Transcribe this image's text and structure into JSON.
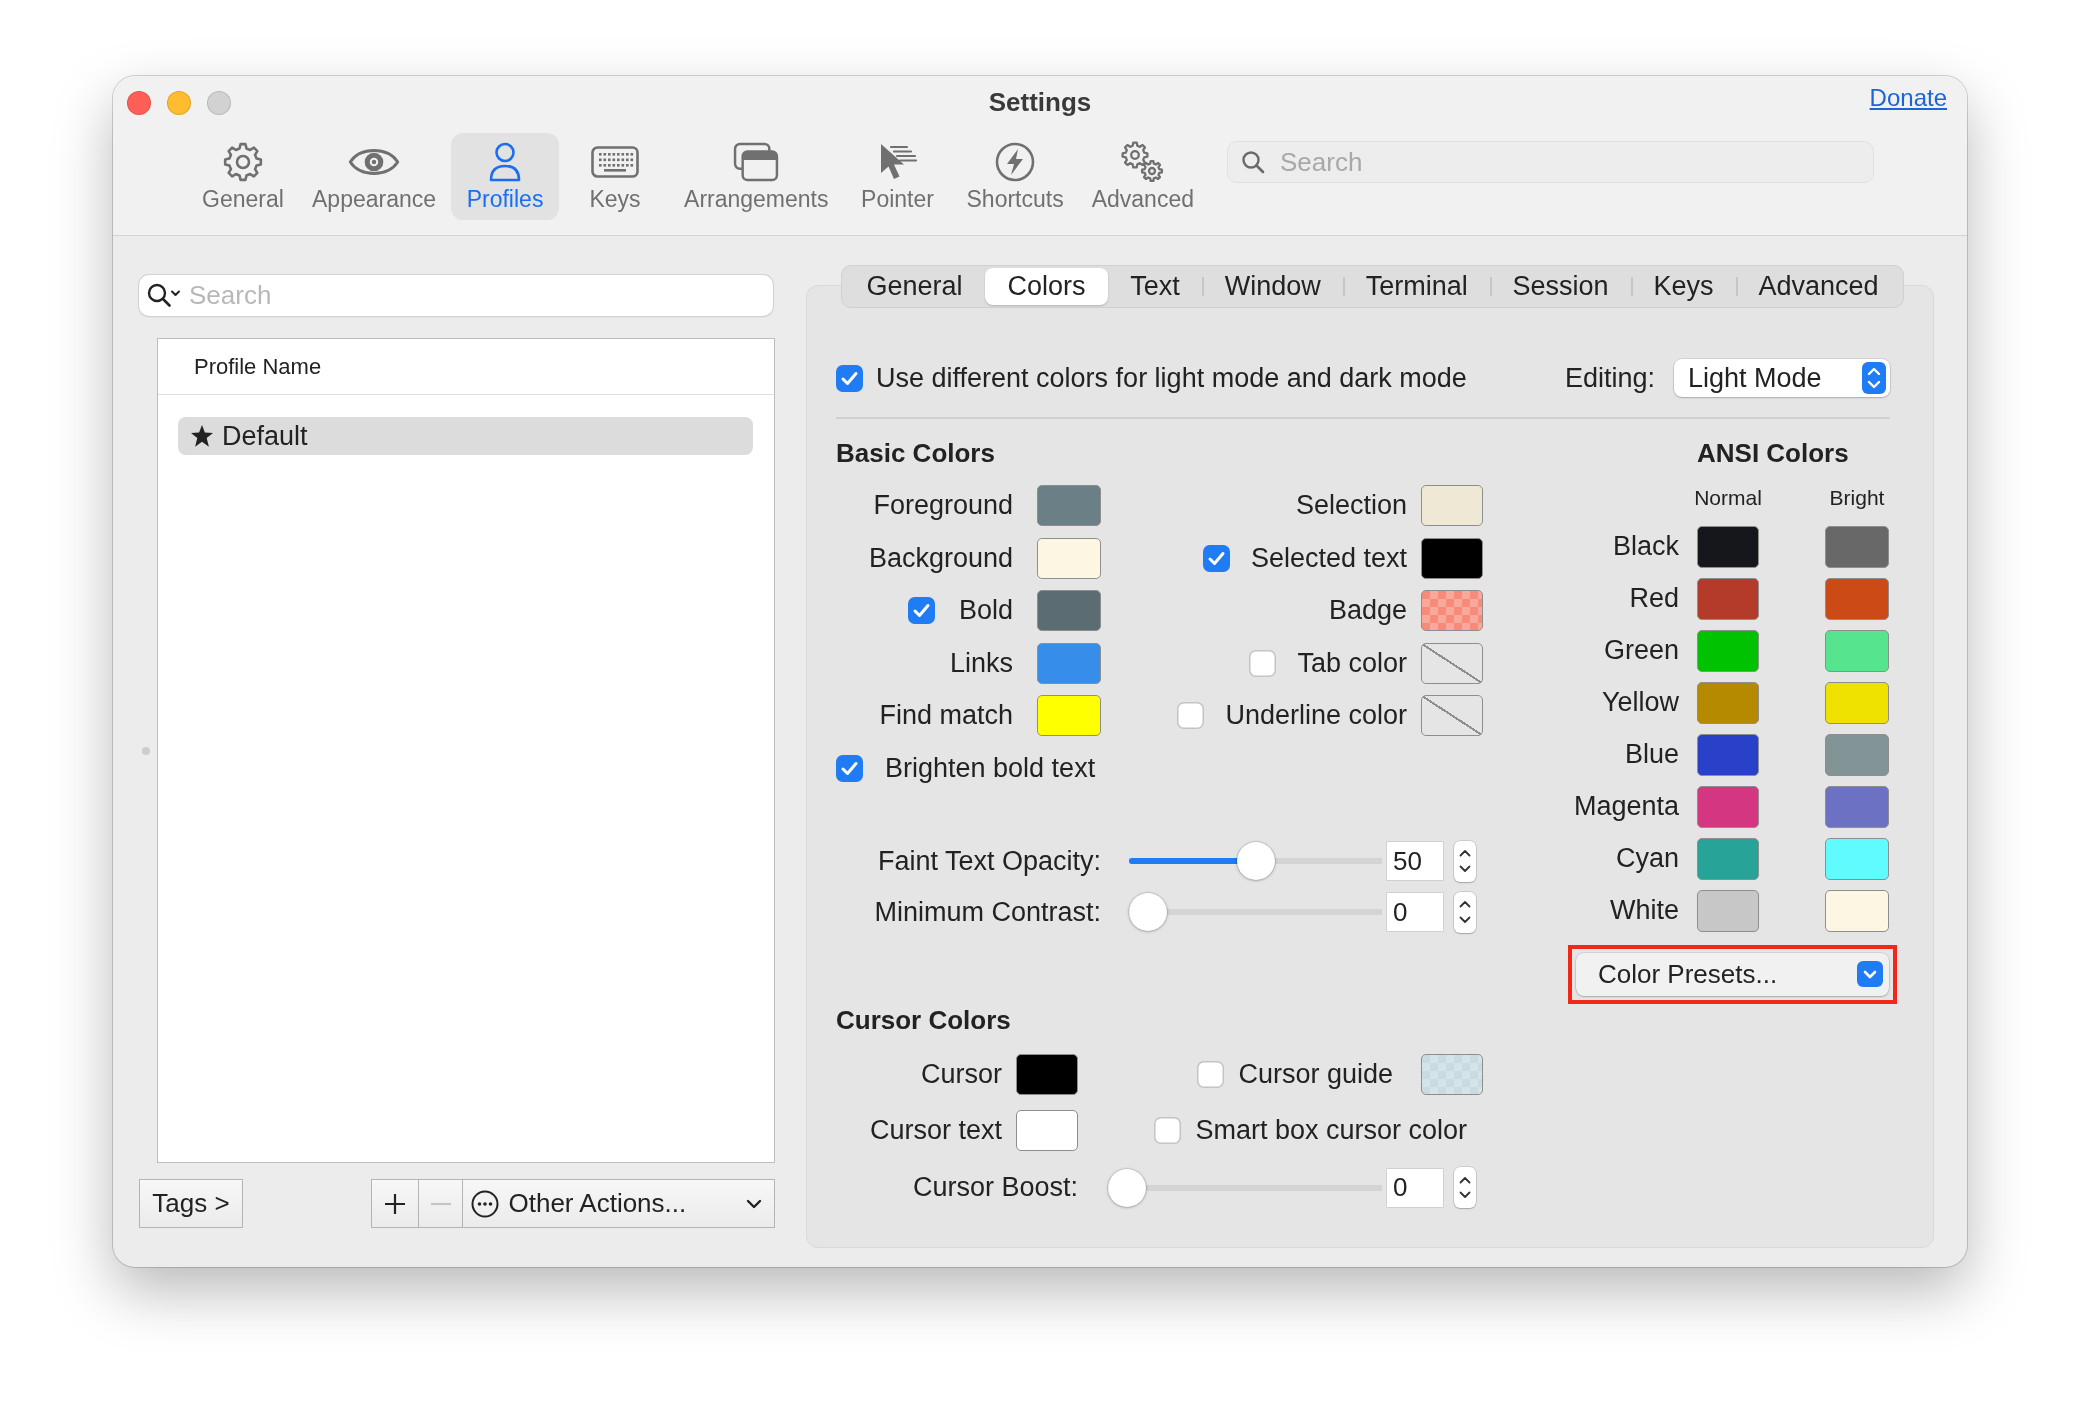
{
  "window": {
    "title": "Settings",
    "controls": [
      {
        "kind": "close",
        "disabled": false
      },
      {
        "kind": "minimize",
        "disabled": false
      },
      {
        "kind": "zoom",
        "disabled": true
      }
    ],
    "link": "Donate"
  },
  "toolbar": {
    "items": [
      {
        "label": "General",
        "selected": false
      },
      {
        "label": "Appearance",
        "selected": false
      },
      {
        "label": "Profiles",
        "selected": true
      },
      {
        "label": "Keys",
        "selected": false
      },
      {
        "label": "Arrangements",
        "selected": false
      },
      {
        "label": "Pointer",
        "selected": false
      },
      {
        "label": "Shortcuts",
        "selected": false
      },
      {
        "label": "Advanced",
        "selected": false
      }
    ],
    "search": {
      "placeholder": "Search"
    }
  },
  "profiles_pane": {
    "search": {
      "placeholder": "Search"
    },
    "table": {
      "columns": [
        "Profile Name"
      ],
      "rows": [
        {
          "name": "Default",
          "default": true,
          "selected": true
        }
      ]
    },
    "tags_button": "Tags >",
    "add_button": {
      "disabled": false
    },
    "remove_button": {
      "disabled": true
    },
    "actions_menu": "Other Actions..."
  },
  "profile_tabs": [
    {
      "label": "General",
      "selected": false
    },
    {
      "label": "Colors",
      "selected": true
    },
    {
      "label": "Text",
      "selected": false
    },
    {
      "label": "Window",
      "selected": false
    },
    {
      "label": "Terminal",
      "selected": false
    },
    {
      "label": "Session",
      "selected": false
    },
    {
      "label": "Keys",
      "selected": false
    },
    {
      "label": "Advanced",
      "selected": false
    }
  ],
  "colors": {
    "mode_toggle": {
      "label": "Use different colors for light mode and dark mode",
      "checked": true
    },
    "editing": {
      "label": "Editing:",
      "value": "Light Mode"
    },
    "basic_colors": {
      "title": "Basic Colors",
      "items": [
        {
          "label": "Foreground",
          "kind": "plain",
          "swatch": {
            "kind": "solid",
            "color": "#6a7f86"
          }
        },
        {
          "label": "Selection",
          "kind": "plain",
          "swatch": {
            "kind": "solid",
            "color": "#eee8d5"
          }
        },
        {
          "label": "Background",
          "kind": "plain",
          "swatch": {
            "kind": "solid",
            "color": "#fdf6e3"
          }
        },
        {
          "label": "Selected text",
          "kind": "checkbox",
          "checked": true,
          "swatch": {
            "kind": "solid",
            "color": "#000000"
          }
        },
        {
          "label": "Bold",
          "kind": "checkbox",
          "checked": true,
          "swatch": {
            "kind": "solid",
            "color": "#5b6d72"
          }
        },
        {
          "label": "Badge",
          "kind": "plain",
          "swatch": {
            "kind": "translucent",
            "color": "#f78b7a"
          }
        },
        {
          "label": "Links",
          "kind": "plain",
          "swatch": {
            "kind": "solid",
            "color": "#368eea"
          }
        },
        {
          "label": "Tab color",
          "kind": "checkbox",
          "checked": false,
          "swatch": {
            "kind": "empty"
          }
        },
        {
          "label": "Find match",
          "kind": "plain",
          "swatch": {
            "kind": "solid",
            "color": "#ffff00"
          }
        },
        {
          "label": "Underline color",
          "kind": "checkbox",
          "checked": false,
          "swatch": {
            "kind": "empty"
          }
        }
      ],
      "brighten_bold": {
        "label": "Brighten bold text",
        "checked": true
      }
    },
    "sliders": [
      {
        "label": "Faint Text Opacity:",
        "level": 0.5,
        "value": "50"
      },
      {
        "label": "Minimum Contrast:",
        "level": 0,
        "value": "0"
      }
    ],
    "cursor_colors": {
      "title": "Cursor Colors",
      "items": [
        {
          "label": "Cursor",
          "kind": "plain",
          "swatch": {
            "kind": "solid",
            "color": "#000000"
          }
        },
        {
          "label": "Cursor guide",
          "kind": "checkbox",
          "checked": false,
          "swatch": {
            "kind": "translucent",
            "color": "#c8dbe1"
          }
        },
        {
          "label": "Cursor text",
          "kind": "plain",
          "swatch": {
            "kind": "solid",
            "color": "#ffffff"
          }
        },
        {
          "label": "Smart box cursor color",
          "kind": "checkbox",
          "checked": false
        }
      ],
      "boost": {
        "label": "Cursor Boost:",
        "level": 0,
        "value": "0"
      }
    },
    "ansi_colors": {
      "title": "ANSI Colors",
      "columns": [
        "Normal",
        "Bright"
      ],
      "rows": [
        {
          "label": "Black",
          "swatches": [
            {
              "color": "#15171b"
            },
            {
              "color": "#686868"
            }
          ]
        },
        {
          "label": "Red",
          "swatches": [
            {
              "color": "#b43b2a"
            },
            {
              "color": "#cb4a16"
            }
          ]
        },
        {
          "label": "Green",
          "swatches": [
            {
              "color": "#00c200"
            },
            {
              "color": "#56e58e"
            }
          ]
        },
        {
          "label": "Yellow",
          "swatches": [
            {
              "color": "#b68a00"
            },
            {
              "color": "#efe200"
            }
          ]
        },
        {
          "label": "Blue",
          "swatches": [
            {
              "color": "#2841c8"
            },
            {
              "color": "#839496"
            }
          ]
        },
        {
          "label": "Magenta",
          "swatches": [
            {
              "color": "#d43681"
            },
            {
              "color": "#6c71c4"
            }
          ]
        },
        {
          "label": "Cyan",
          "swatches": [
            {
              "color": "#28a398"
            },
            {
              "color": "#5ffbff"
            }
          ]
        },
        {
          "label": "White",
          "swatches": [
            {
              "color": "#c7c7c7"
            },
            {
              "color": "#fdf6e3"
            }
          ]
        }
      ]
    },
    "presets": {
      "label": "Color Presets...",
      "highlighted": true
    }
  }
}
